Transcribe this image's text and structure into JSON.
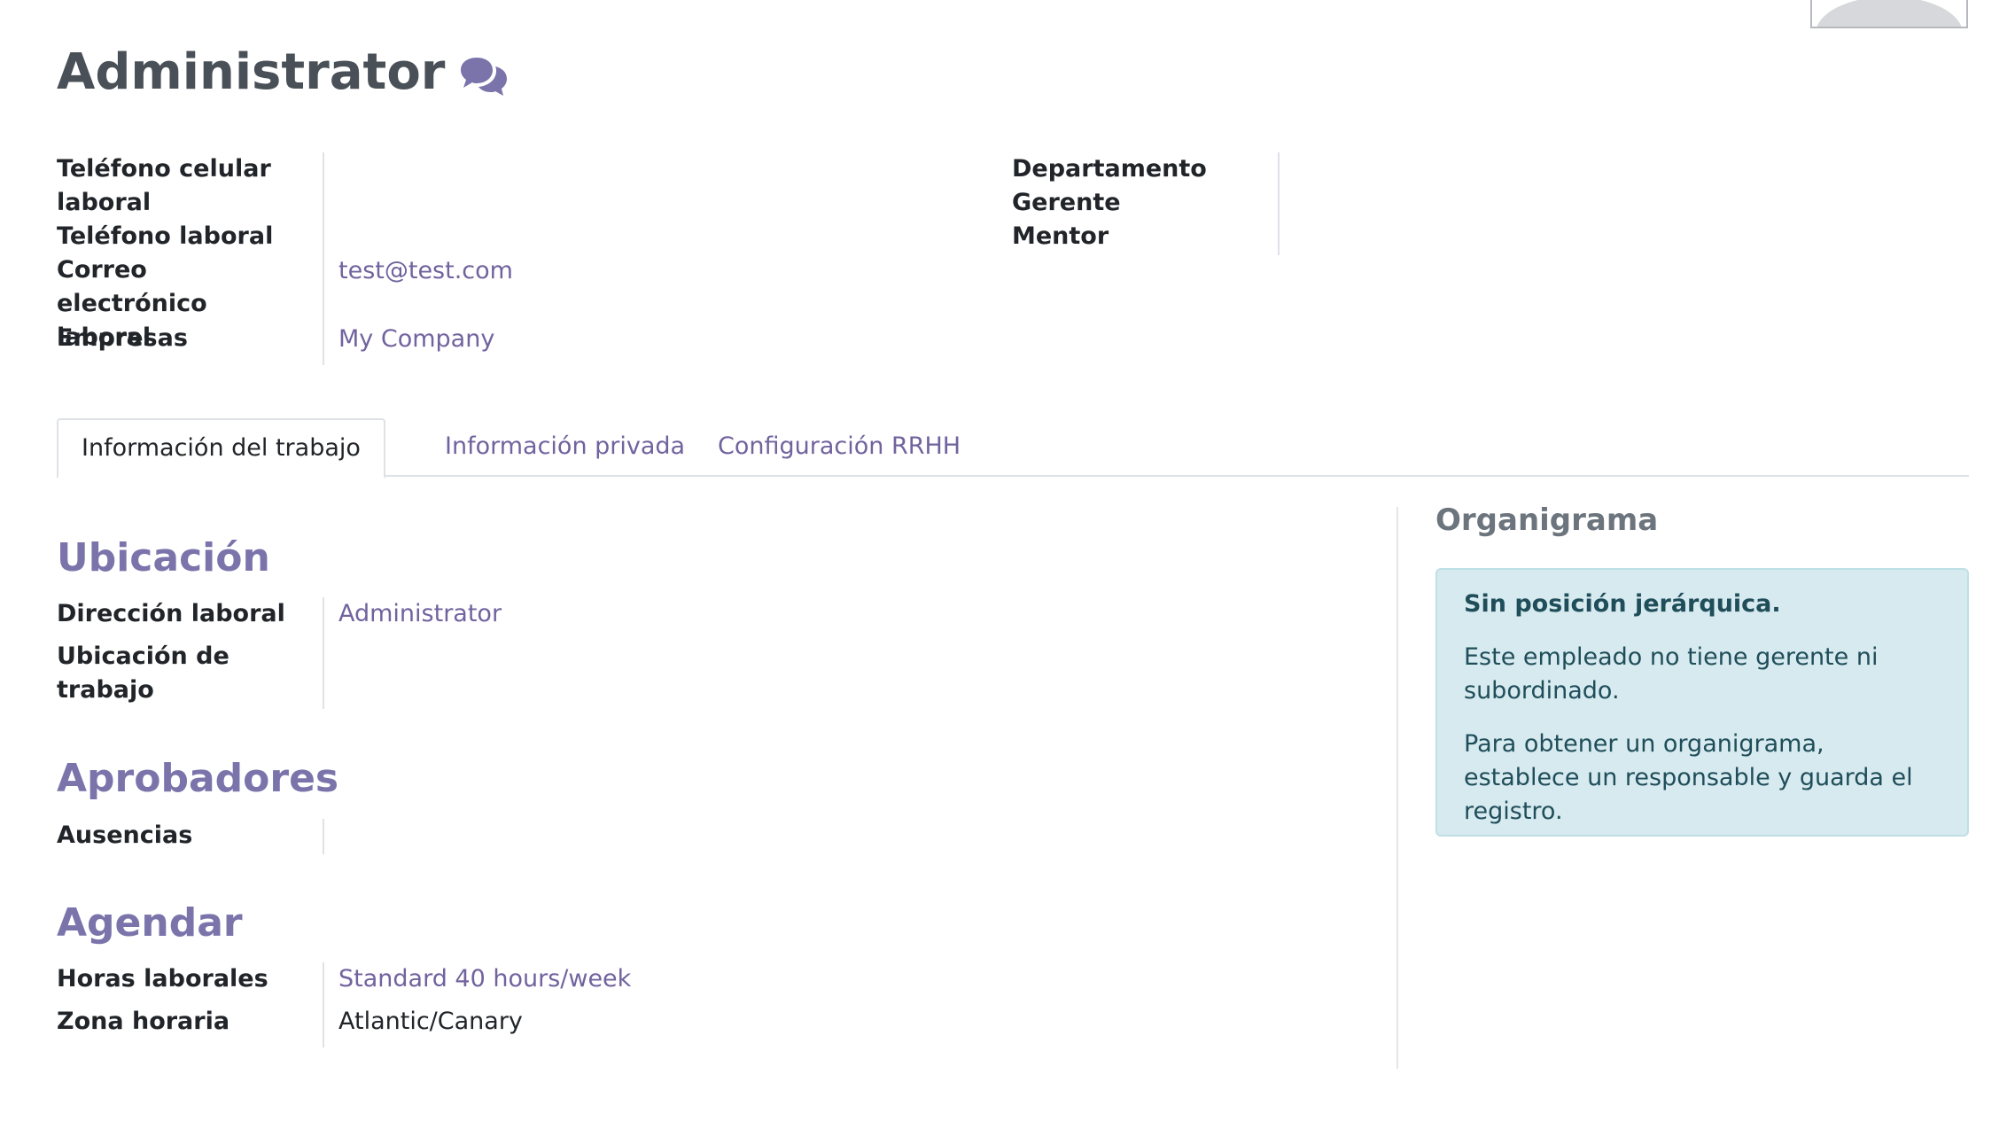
{
  "header": {
    "title": "Administrator",
    "chat_icon": "comments-icon"
  },
  "contact": {
    "mobile_label": "Teléfono celular laboral",
    "phone_label": "Teléfono laboral",
    "email_label": "Correo electrónico laboral",
    "email_value": "test@test.com",
    "company_label": "Empresas",
    "company_value": "My Company",
    "department_label": "Departamento",
    "manager_label": "Gerente",
    "coach_label": "Mentor"
  },
  "tabs": [
    {
      "label": "Información del trabajo",
      "active": true
    },
    {
      "label": "Información privada",
      "active": false
    },
    {
      "label": "Configuración RRHH",
      "active": false
    }
  ],
  "work_info": {
    "location_title": "Ubicación",
    "work_address_label": "Dirección laboral",
    "work_address_value": "Administrator",
    "work_location_label": "Ubicación de trabajo",
    "approvers_title": "Aprobadores",
    "leave_label": "Ausencias",
    "schedule_title": "Agendar",
    "working_hours_label": "Horas laborales",
    "working_hours_value": "Standard 40 hours/week",
    "timezone_label": "Zona horaria",
    "timezone_value": "Atlantic/Canary"
  },
  "org_chart": {
    "title": "Organigrama",
    "alert_title": "Sin posición jerárquica.",
    "alert_line1": "Este empleado no tiene gerente ni subordinado.",
    "alert_line2": "Para obtener un organigrama, establece un responsable y guarda el registro."
  },
  "colors": {
    "link": "#71639e",
    "section_title": "#7a74ab",
    "alert_bg": "#d7eaef"
  }
}
